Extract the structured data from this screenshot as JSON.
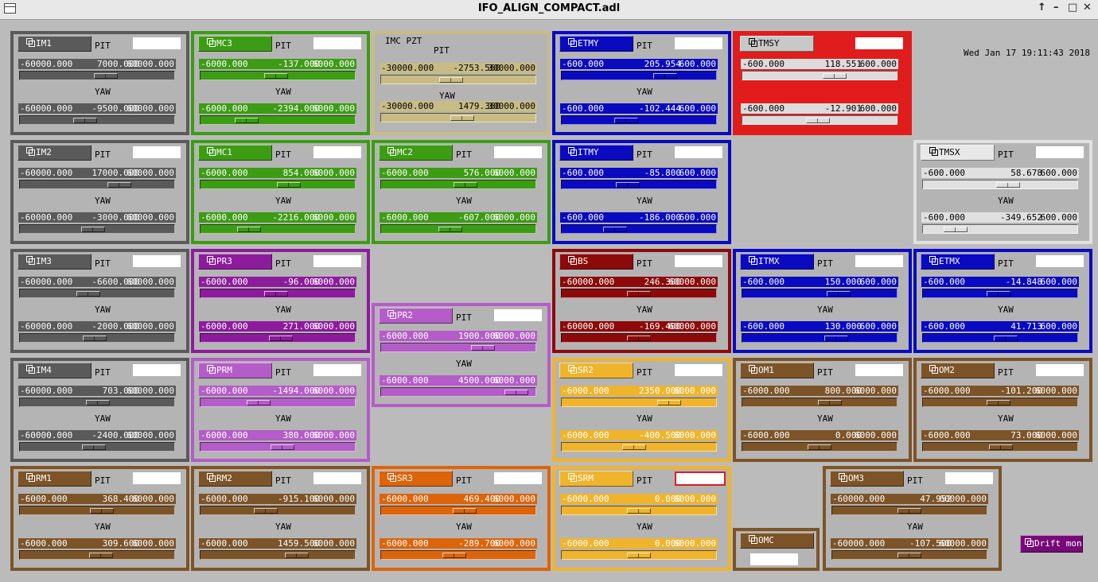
{
  "window": {
    "title": "IFO_ALIGN_COMPACT.adl"
  },
  "clock": "Wed Jan 17 19:11:43 2018",
  "labels": {
    "pit": "PIT",
    "yaw": "YAW"
  },
  "themes": {
    "gray": {
      "border": "#5a5a5a",
      "bg": "#b4b4b4",
      "btn": "#5a5a5a",
      "btnText": "#ffffff",
      "slider": "#5a5a5a",
      "sliderText": "#ffffff"
    },
    "green": {
      "border": "#3c9c14",
      "bg": "#b4b4b4",
      "btn": "#3c9c14",
      "btnText": "#ffffff",
      "slider": "#3c9c14",
      "sliderText": "#ffffff"
    },
    "tan": {
      "border": "#c8bc84",
      "bg": "#b4b4b4",
      "btn": "#c8bc84",
      "btnText": "#000000",
      "slider": "#c8bc84",
      "sliderText": "#000000"
    },
    "blue": {
      "border": "#0a0ac0",
      "bg": "#b4b4b4",
      "btn": "#0a0ac0",
      "btnText": "#ffffff",
      "slider": "#0a0ac0",
      "sliderText": "#ffffff"
    },
    "red": {
      "border": "#e01c1c",
      "bg": "#e01c1c",
      "btn": "#c8c8c8",
      "btnText": "#000000",
      "slider": "#dcdcdc",
      "sliderText": "#000000"
    },
    "white": {
      "border": "#e0e0e0",
      "bg": "#b4b4b4",
      "btn": "#e8e8e8",
      "btnText": "#000000",
      "slider": "#e0e0e0",
      "sliderText": "#000000"
    },
    "purple": {
      "border": "#8c1c9c",
      "bg": "#b4b4b4",
      "btn": "#8c1c9c",
      "btnText": "#ffffff",
      "slider": "#8c1c9c",
      "sliderText": "#ffffff"
    },
    "lilac": {
      "border": "#b45cc8",
      "bg": "#b4b4b4",
      "btn": "#b45cc8",
      "btnText": "#ffffff",
      "slider": "#b45cc8",
      "sliderText": "#ffffff"
    },
    "darkred": {
      "border": "#8c0a0a",
      "bg": "#b4b4b4",
      "btn": "#8c0a0a",
      "btnText": "#ffffff",
      "slider": "#8c0a0a",
      "sliderText": "#ffffff"
    },
    "yellow": {
      "border": "#f0b42c",
      "bg": "#b4b4b4",
      "btn": "#f0b42c",
      "btnText": "#ffffff",
      "slider": "#f0b42c",
      "sliderText": "#ffffff"
    },
    "brown": {
      "border": "#7c5428",
      "bg": "#b4b4b4",
      "btn": "#7c5428",
      "btnText": "#ffffff",
      "slider": "#7c5428",
      "sliderText": "#ffffff"
    },
    "orange": {
      "border": "#dc640a",
      "bg": "#b4b4b4",
      "btn": "#dc640a",
      "btnText": "#ffffff",
      "slider": "#dc640a",
      "sliderText": "#ffffff"
    }
  },
  "panels": [
    {
      "id": "im1",
      "name": "IM1",
      "theme": "gray",
      "pit": {
        "lo": "-60000.000",
        "val": "7000.000",
        "hi": "60000.000",
        "frac": 0.558
      },
      "yaw": {
        "lo": "-60000.000",
        "val": "-9500.000",
        "hi": "60000.000",
        "frac": 0.421
      }
    },
    {
      "id": "im2",
      "name": "IM2",
      "theme": "gray",
      "pit": {
        "lo": "-60000.000",
        "val": "17000.000",
        "hi": "60000.000",
        "frac": 0.642
      },
      "yaw": {
        "lo": "-60000.000",
        "val": "-3000.000",
        "hi": "60000.000",
        "frac": 0.475
      }
    },
    {
      "id": "im3",
      "name": "IM3",
      "theme": "gray",
      "pit": {
        "lo": "-60000.000",
        "val": "-6600.000",
        "hi": "60000.000",
        "frac": 0.445
      },
      "yaw": {
        "lo": "-60000.000",
        "val": "-2000.000",
        "hi": "60000.000",
        "frac": 0.483
      }
    },
    {
      "id": "im4",
      "name": "IM4",
      "theme": "gray",
      "pit": {
        "lo": "-60000.000",
        "val": "703.000",
        "hi": "60000.000",
        "frac": 0.506
      },
      "yaw": {
        "lo": "-60000.000",
        "val": "-2400.000",
        "hi": "60000.000",
        "frac": 0.48
      }
    },
    {
      "id": "rm1",
      "name": "RM1",
      "theme": "brown",
      "pit": {
        "lo": "-6000.000",
        "val": "368.400",
        "hi": "6000.000",
        "frac": 0.531
      },
      "yaw": {
        "lo": "-6000.000",
        "val": "309.600",
        "hi": "6000.000",
        "frac": 0.526
      }
    },
    {
      "id": "mc3",
      "name": "MC3",
      "theme": "green",
      "pit": {
        "lo": "-6000.000",
        "val": "-137.000",
        "hi": "6000.000",
        "frac": 0.489
      },
      "yaw": {
        "lo": "-6000.000",
        "val": "-2394.000",
        "hi": "6000.000",
        "frac": 0.3
      }
    },
    {
      "id": "mc1",
      "name": "MC1",
      "theme": "green",
      "pit": {
        "lo": "-6000.000",
        "val": "854.000",
        "hi": "6000.000",
        "frac": 0.571
      },
      "yaw": {
        "lo": "-6000.000",
        "val": "-2216.000",
        "hi": "6000.000",
        "frac": 0.315
      }
    },
    {
      "id": "pr3",
      "name": "PR3",
      "theme": "purple",
      "pit": {
        "lo": "-6000.000",
        "val": "-96.000",
        "hi": "6000.000",
        "frac": 0.492
      },
      "yaw": {
        "lo": "-6000.000",
        "val": "271.000",
        "hi": "6000.000",
        "frac": 0.523
      }
    },
    {
      "id": "prm",
      "name": "PRM",
      "theme": "lilac",
      "pit": {
        "lo": "-6000.000",
        "val": "-1494.000",
        "hi": "6000.000",
        "frac": 0.376
      },
      "yaw": {
        "lo": "-6000.000",
        "val": "380.000",
        "hi": "6000.000",
        "frac": 0.532
      }
    },
    {
      "id": "rm2",
      "name": "RM2",
      "theme": "brown",
      "pit": {
        "lo": "-6000.000",
        "val": "-915.100",
        "hi": "6000.000",
        "frac": 0.424
      },
      "yaw": {
        "lo": "-6000.000",
        "val": "1459.500",
        "hi": "6000.000",
        "frac": 0.622
      }
    },
    {
      "id": "imcpzt",
      "title": "IMC PZT",
      "theme": "tan",
      "pit": {
        "lo": "-30000.000",
        "val": "-2753.560",
        "hi": "30000.000",
        "frac": 0.454
      },
      "yaw": {
        "lo": "-30000.000",
        "val": "1479.360",
        "hi": "30000.000",
        "frac": 0.525
      }
    },
    {
      "id": "mc2",
      "name": "MC2",
      "theme": "green",
      "pit": {
        "lo": "-6000.000",
        "val": "576.000",
        "hi": "6000.000",
        "frac": 0.548
      },
      "yaw": {
        "lo": "-6000.000",
        "val": "-607.000",
        "hi": "6000.000",
        "frac": 0.449
      }
    },
    {
      "id": "pr2",
      "name": "PR2",
      "theme": "lilac",
      "pit": {
        "lo": "-6000.000",
        "val": "1900.000",
        "hi": "6000.000",
        "frac": 0.658
      },
      "yaw": {
        "lo": "-6000.000",
        "val": "4500.000",
        "hi": "6000.000",
        "frac": 0.875
      }
    },
    {
      "id": "sr3",
      "name": "SR3",
      "theme": "orange",
      "pit": {
        "lo": "-6000.000",
        "val": "469.400",
        "hi": "6000.000",
        "frac": 0.539
      },
      "yaw": {
        "lo": "-6000.000",
        "val": "-289.700",
        "hi": "6000.000",
        "frac": 0.476
      }
    },
    {
      "id": "etmy",
      "name": "ETMY",
      "theme": "blue",
      "pit": {
        "lo": "-600.000",
        "val": "205.954",
        "hi": "600.000",
        "frac": 0.672
      },
      "yaw": {
        "lo": "-600.000",
        "val": "-102.444",
        "hi": "600.000",
        "frac": 0.415
      }
    },
    {
      "id": "itmy",
      "name": "ITMY",
      "theme": "blue",
      "pit": {
        "lo": "-600.000",
        "val": "-85.800",
        "hi": "600.000",
        "frac": 0.429
      },
      "yaw": {
        "lo": "-600.000",
        "val": "-186.000",
        "hi": "600.000",
        "frac": 0.345
      }
    },
    {
      "id": "bs",
      "name": "BS",
      "theme": "darkred",
      "pit": {
        "lo": "-60000.000",
        "val": "246.300",
        "hi": "60000.000",
        "frac": 0.502
      },
      "yaw": {
        "lo": "-60000.000",
        "val": "-169.400",
        "hi": "60000.000",
        "frac": 0.499
      }
    },
    {
      "id": "sr2",
      "name": "SR2",
      "theme": "yellow",
      "pit": {
        "lo": "-6000.000",
        "val": "2350.000",
        "hi": "6000.000",
        "frac": 0.696
      },
      "yaw": {
        "lo": "-6000.000",
        "val": "-400.500",
        "hi": "6000.000",
        "frac": 0.467
      }
    },
    {
      "id": "srm",
      "name": "SRM",
      "theme": "yellow",
      "pit": {
        "lo": "-6000.000",
        "val": "0.000",
        "hi": "6000.000",
        "frac": 0.5
      },
      "yaw": {
        "lo": "-6000.000",
        "val": "0.000",
        "hi": "6000.000",
        "frac": 0.5
      }
    },
    {
      "id": "tmsy",
      "name": "TMSY",
      "theme": "red",
      "pit": {
        "lo": "-600.000",
        "val": "118.551",
        "hi": "600.000",
        "frac": 0.599
      },
      "yaw": {
        "lo": "-600.000",
        "val": "-12.901",
        "hi": "600.000",
        "frac": 0.489
      }
    },
    {
      "id": "itmx",
      "name": "ITMX",
      "theme": "blue",
      "pit": {
        "lo": "-600.000",
        "val": "150.000",
        "hi": "600.000",
        "frac": 0.625
      },
      "yaw": {
        "lo": "-600.000",
        "val": "130.000",
        "hi": "600.000",
        "frac": 0.608
      }
    },
    {
      "id": "om1",
      "name": "OM1",
      "theme": "brown",
      "pit": {
        "lo": "-6000.000",
        "val": "800.000",
        "hi": "6000.000",
        "frac": 0.567
      },
      "yaw": {
        "lo": "-6000.000",
        "val": "0.000",
        "hi": "6000.000",
        "frac": 0.5
      }
    },
    {
      "id": "omc",
      "name": "OMC",
      "theme": "brown"
    },
    {
      "id": "om3",
      "name": "OM3",
      "theme": "brown",
      "pit": {
        "lo": "-60000.000",
        "val": "47.952",
        "hi": "60000.000",
        "frac": 0.5
      },
      "yaw": {
        "lo": "-60000.000",
        "val": "-107.500",
        "hi": "60000.000",
        "frac": 0.5
      }
    },
    {
      "id": "tmsx",
      "name": "TMSX",
      "theme": "white",
      "pit": {
        "lo": "-600.000",
        "val": "58.678",
        "hi": "600.000",
        "frac": 0.549
      },
      "yaw": {
        "lo": "-600.000",
        "val": "-349.652",
        "hi": "600.000",
        "frac": 0.209
      }
    },
    {
      "id": "etmx",
      "name": "ETMX",
      "theme": "blue",
      "pit": {
        "lo": "-600.000",
        "val": "-14.848",
        "hi": "600.000",
        "frac": 0.488
      },
      "yaw": {
        "lo": "-600.000",
        "val": "41.713",
        "hi": "600.000",
        "frac": 0.535
      }
    },
    {
      "id": "om2",
      "name": "OM2",
      "theme": "brown",
      "pit": {
        "lo": "-6000.000",
        "val": "-101.200",
        "hi": "6000.000",
        "frac": 0.492
      },
      "yaw": {
        "lo": "-6000.000",
        "val": "73.000",
        "hi": "6000.000",
        "frac": 0.506
      }
    }
  ],
  "drift": {
    "label": "Drift mon",
    "color": "#780a78",
    "text": "#ffffff"
  }
}
